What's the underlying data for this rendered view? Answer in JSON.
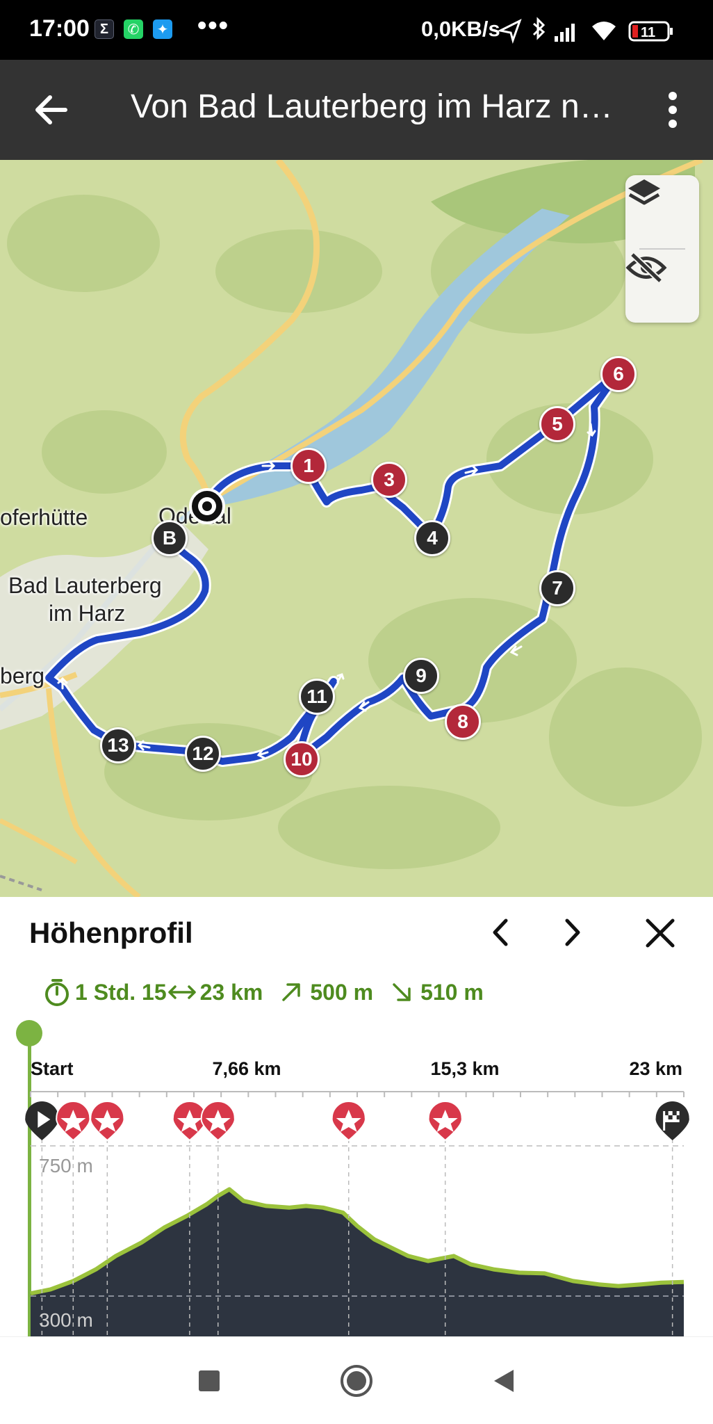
{
  "status_bar": {
    "time": "17:00",
    "notification_icons": [
      "sigma-icon",
      "whatsapp-icon",
      "twitter-icon"
    ],
    "more": "•••",
    "network_speed": "0,0KB/s",
    "battery_level": "11"
  },
  "app_bar": {
    "title": "Von Bad Lauterberg im Harz nach Odertal",
    "back_icon": "arrow-left-icon",
    "menu_icon": "more-vert-icon"
  },
  "map": {
    "labels": {
      "kupferhuette": "oferhütte",
      "bad_lauterberg_line1": "Bad Lauterberg",
      "bad_lauterberg_line2": "im Harz",
      "lauterberg_partial": "berg",
      "odertal": "Odertal"
    },
    "start_marker": "B",
    "waypoints": [
      "1",
      "3",
      "4",
      "5",
      "6",
      "7",
      "8",
      "9",
      "10",
      "11",
      "12",
      "13"
    ],
    "controls": {
      "layers_icon": "layers-icon",
      "hide_icon": "eye-off-icon"
    }
  },
  "sheet": {
    "title": "Höhenprofil",
    "prev_icon": "chevron-left-icon",
    "next_icon": "chevron-right-icon",
    "close_icon": "close-icon",
    "stats": {
      "duration": "1 Std. 15",
      "distance": "23 km",
      "ascent": "500 m",
      "descent": "510 m"
    },
    "profile": {
      "x_labels": [
        "Start",
        "7,66 km",
        "15,3 km",
        "23 km"
      ],
      "y_top_label": "750 m",
      "y_bottom_label": "300 m"
    }
  },
  "chart_data": {
    "type": "area",
    "title": "Höhenprofil",
    "x_unit": "km",
    "y_unit": "m",
    "x_ticks": [
      "Start",
      "7,66 km",
      "15,3 km",
      "23 km"
    ],
    "y_ticks": [
      "750 m",
      "300 m"
    ],
    "xlim": [
      0,
      23
    ],
    "ylim": [
      300,
      750
    ],
    "grid": true,
    "series": [
      {
        "x": [
          0,
          0.7,
          1.5,
          2.3,
          3.0,
          3.9,
          4.7,
          5.5,
          6.2,
          6.6,
          7.0,
          7.5,
          8.3,
          9.1,
          9.7,
          10.3,
          11.0,
          11.5,
          12.1,
          12.7,
          13.3,
          14.0,
          14.9,
          15.5,
          16.3,
          17.2,
          18.1,
          19.1,
          20.0,
          20.7,
          21.5,
          22.2,
          23.0
        ],
        "y": [
          308,
          320,
          345,
          380,
          420,
          460,
          505,
          540,
          575,
          600,
          620,
          585,
          570,
          565,
          570,
          565,
          550,
          510,
          470,
          445,
          420,
          405,
          420,
          395,
          380,
          370,
          368,
          345,
          335,
          330,
          335,
          340,
          342
        ]
      }
    ],
    "pois": [
      {
        "type": "start",
        "x": 0.4
      },
      {
        "type": "highlight",
        "x": 1.5
      },
      {
        "type": "highlight",
        "x": 2.7
      },
      {
        "type": "highlight",
        "x": 5.6
      },
      {
        "type": "highlight",
        "x": 6.6
      },
      {
        "type": "highlight",
        "x": 11.2
      },
      {
        "type": "highlight",
        "x": 14.6
      },
      {
        "type": "finish",
        "x": 22.6
      }
    ]
  },
  "nav_bar": {
    "recents_icon": "square-icon",
    "home_icon": "circle-icon",
    "back_icon": "triangle-back-icon"
  }
}
